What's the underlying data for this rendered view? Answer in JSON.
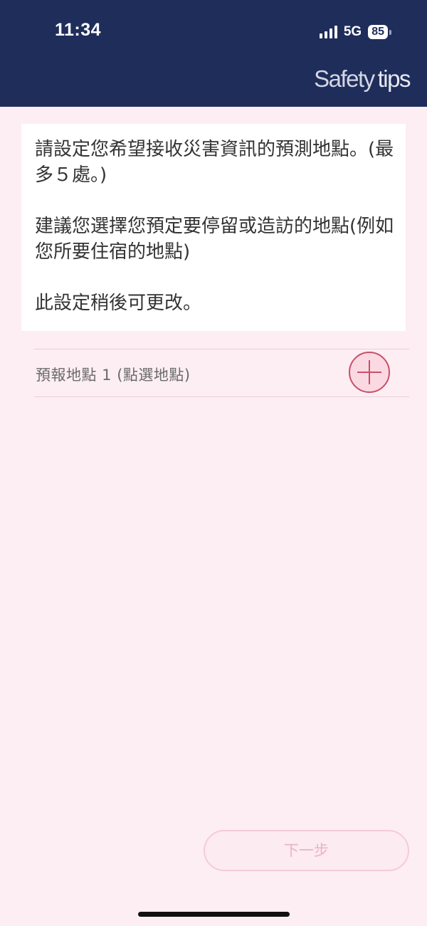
{
  "status_bar": {
    "time": "11:34",
    "network": "5G",
    "battery": "85"
  },
  "header": {
    "brand_part1": "Safety",
    "brand_part2": "tips"
  },
  "intro": {
    "paragraph1": "請設定您希望接收災害資訊的預測地點。(最多５處。)",
    "paragraph2": "建議您選擇您預定要停留或造訪的地點(例如您所要住宿的地點)",
    "paragraph3": "此設定稍後可更改。"
  },
  "location": {
    "label": "預報地點 1 (點選地點)",
    "add_icon": "plus-icon"
  },
  "footer": {
    "next_label": "下一步"
  }
}
